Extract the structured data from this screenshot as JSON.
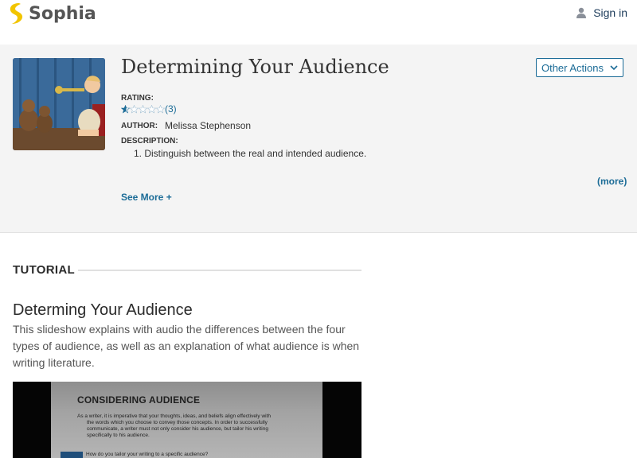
{
  "header": {
    "logo_text": "Sophia",
    "brand_color": "#f2c500",
    "signin_label": "Sign in"
  },
  "hero": {
    "title": "Determining Your Audience",
    "other_actions_label": "Other Actions",
    "rating_label": "RATING:",
    "rating_value": 1,
    "rating_max": 5,
    "rating_count": "(3)",
    "author_label": "AUTHOR:",
    "author_name": "Melissa Stephenson",
    "description_label": "DESCRIPTION:",
    "description_text": "1. Distinguish between the real and intended audience.",
    "more_link": "(more)",
    "see_more_label": "See More +"
  },
  "tutorial": {
    "section_label": "TUTORIAL",
    "heading": "Determing Your Audience",
    "summary": "This slideshow explains with audio the differences between the four types of audience, as well as an explanation of what audience is when writing literature."
  },
  "video_slide": {
    "title": "CONSIDERING AUDIENCE",
    "body_line1": "As a writer, it is imperative that your thoughts, ideas, and beliefs align effectively with",
    "body_line2": "the words which you choose to convey those concepts.  In order to successfully",
    "body_line3": "communicate, a writer must not only consider his audience, but tailor his writing",
    "body_line4": "specifically to his audience.",
    "question": "How do you tailor your writing to a specific audience?"
  },
  "colors": {
    "link": "#1c6c97",
    "hero_bg": "#f4f4f4"
  }
}
